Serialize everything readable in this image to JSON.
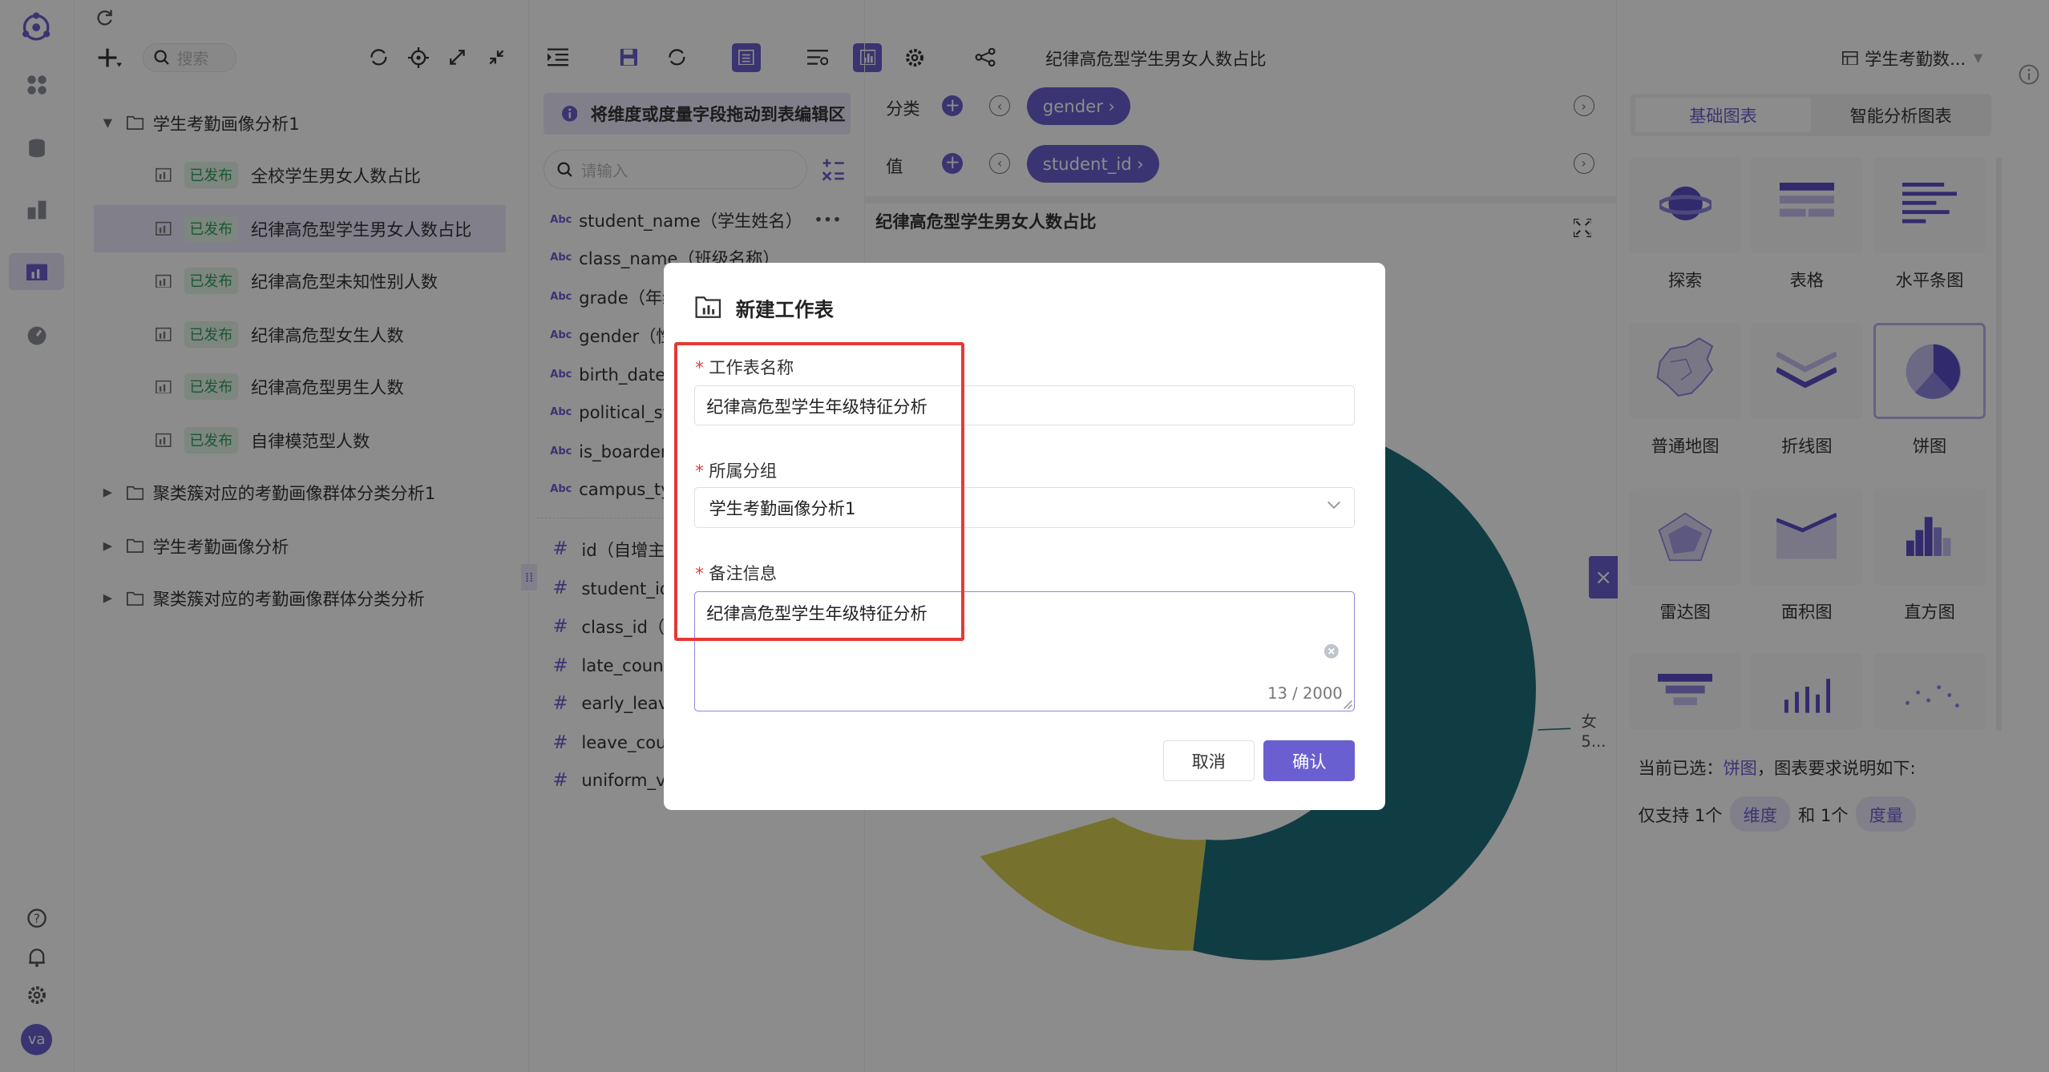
{
  "colors": {
    "accent": "#6a5fd0",
    "highlight": "#e53935",
    "published_text": "#2f9e58",
    "donut_teal": "#1e6f7a",
    "donut_yellow": "#d8cf55"
  },
  "rail": {
    "icons": [
      "logo-icon",
      "apps-icon",
      "database-icon",
      "dashboard-icon",
      "folder-chart-icon",
      "gauge-icon",
      "help-icon",
      "bell-icon",
      "gear-icon"
    ],
    "avatar": "va"
  },
  "left": {
    "search_placeholder": "搜索",
    "tree": [
      {
        "label": "学生考勤画像分析1",
        "expanded": true
      },
      {
        "label": "全校学生男女人数占比",
        "badge": "已发布"
      },
      {
        "label": "纪律高危型学生男女人数占比",
        "badge": "已发布",
        "selected": true
      },
      {
        "label": "纪律高危型未知性别人数",
        "badge": "已发布"
      },
      {
        "label": "纪律高危型女生人数",
        "badge": "已发布"
      },
      {
        "label": "纪律高危型男生人数",
        "badge": "已发布"
      },
      {
        "label": "自律模范型人数",
        "badge": "已发布"
      },
      {
        "label": "聚类簇对应的考勤画像群体分类分析1"
      },
      {
        "label": "学生考勤画像分析"
      },
      {
        "label": "聚类簇对应的考勤画像群体分类分析"
      }
    ]
  },
  "toolbar": {
    "chart_title": "纪律高危型学生男女人数占比",
    "dataset": "学生考勤数..."
  },
  "fields": {
    "hint": "将维度或度量字段拖动到表编辑区",
    "search_placeholder": "请输入",
    "dimensions": [
      "student_name（学生姓名）",
      "class_name（班级名称）",
      "grade（年级",
      "gender（性",
      "birth_date",
      "political_st",
      "is_boarder",
      "campus_ty"
    ],
    "measures": [
      "id（自增主",
      "student_id",
      "class_id（",
      "late_count",
      "early_leave",
      "leave_coun",
      "uniform_vi"
    ]
  },
  "canvas": {
    "category_label": "分类",
    "category_pill": "gender",
    "value_label": "值",
    "value_pill": "student_id",
    "chart_title": "纪律高危型学生男女人数占比",
    "label_line1": "女",
    "label_line2": "5..."
  },
  "right": {
    "tabs": [
      "基础图表",
      "智能分析图表"
    ],
    "chart_types": [
      "探索",
      "表格",
      "水平条图",
      "普通地图",
      "折线图",
      "饼图",
      "雷达图",
      "面积图",
      "直方图"
    ],
    "selected_prefix": "当前已选：",
    "selected_type": "饼图",
    "selected_suffix": "，图表要求说明如下:",
    "req_p1": "仅支持 1个",
    "req_dim": "维度",
    "req_p2": "和 1个",
    "req_measure": "度量"
  },
  "dialog": {
    "title": "新建工作表",
    "name_label": "工作表名称",
    "name_value": "纪律高危型学生年级特征分析",
    "group_label": "所属分组",
    "group_value": "学生考勤画像分析1",
    "note_label": "备注信息",
    "note_value": "纪律高危型学生年级特征分析",
    "counter": "13 / 2000",
    "cancel": "取消",
    "confirm": "确认"
  },
  "chart_data": {
    "type": "pie",
    "title": "纪律高危型学生男女人数占比",
    "categories": [
      "女",
      "5..."
    ]
  }
}
